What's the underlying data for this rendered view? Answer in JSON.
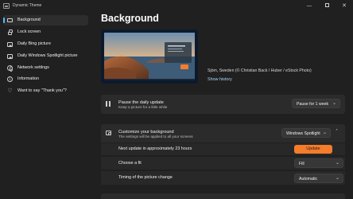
{
  "window": {
    "title": "Dynamic Theme",
    "minimize_glyph": "—",
    "close_glyph": "✕"
  },
  "sidebar": {
    "items": [
      {
        "label": "Background",
        "icon": "monitor-icon",
        "active": true
      },
      {
        "label": "Lock screen",
        "icon": "lock-icon"
      },
      {
        "label": "Daily Bing picture",
        "icon": "picture-icon"
      },
      {
        "label": "Daily Windows Spotlight picture",
        "icon": "picture-icon"
      },
      {
        "label": "Network settings",
        "icon": "globe-icon"
      },
      {
        "label": "Information",
        "icon": "info-icon"
      },
      {
        "label": "Want to say \"Thank you\"?",
        "icon": "heart-icon"
      }
    ],
    "info_glyph": "i",
    "heart_glyph": "♡"
  },
  "main": {
    "title": "Background",
    "preview": {
      "credit": "Sjöm, Sweden (© Christian Back / Huber / eStock Photo)",
      "show_history": "Show history"
    },
    "pause": {
      "title": "Pause the daily update",
      "subtitle": "Keep a picture for a little while",
      "value": "Pause for 1 week"
    },
    "customize": {
      "title": "Customize your background",
      "subtitle": "The settings will be applied to all your screens",
      "value": "Windows Spotlight",
      "next_update_label": "Next update in approximately 23 hours",
      "update_button": "Update",
      "fit_label": "Choose a fit",
      "fit_value": "Fill",
      "timing_label": "Timing of the picture change",
      "timing_value": "Automatic"
    },
    "chevron_down": "⌄",
    "chevron_up": "˄"
  },
  "colors": {
    "accent": "#4cc2ff",
    "update_button": "#f57c2b",
    "background": "#202020",
    "card": "#2b2b2b"
  }
}
